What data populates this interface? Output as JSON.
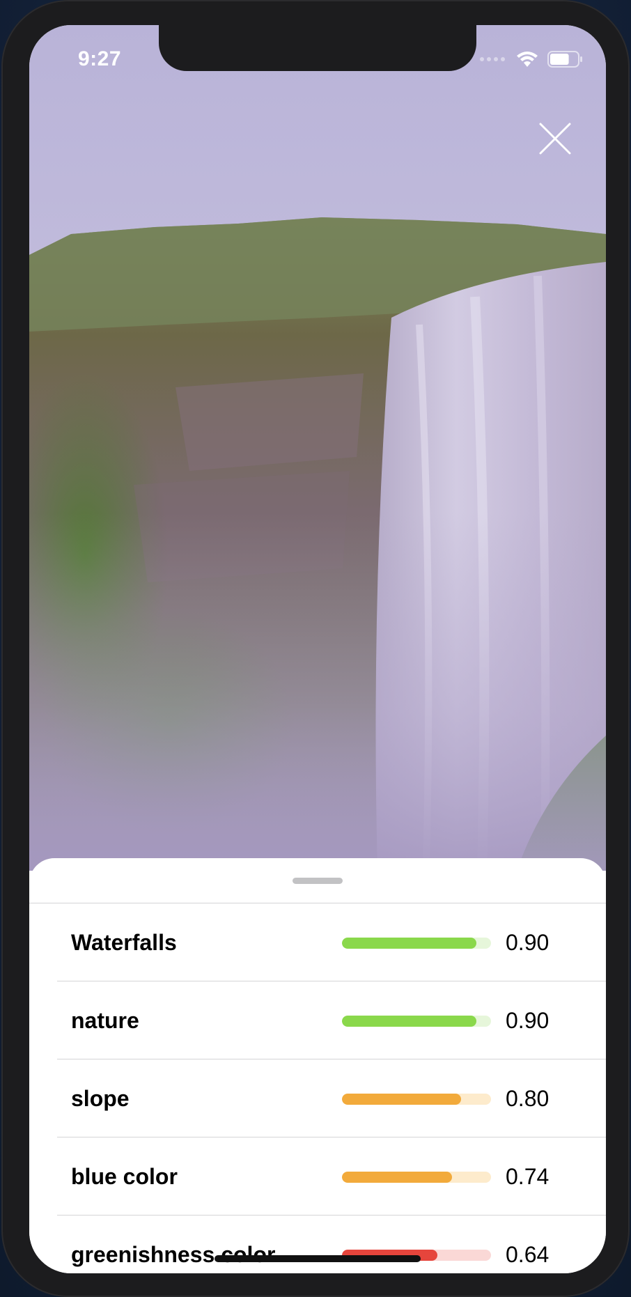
{
  "status_bar": {
    "time": "9:27",
    "signal_icon": "cellular-signal-icon",
    "wifi_icon": "wifi-icon",
    "battery_icon": "battery-icon",
    "battery_level": 0.7
  },
  "photo": {
    "subject": "waterfall-photo",
    "close_icon": "close-icon"
  },
  "results": {
    "items": [
      {
        "label": "Waterfalls",
        "score": "0.90",
        "level": 0.9,
        "color": "#8ad84b",
        "track": "#e6f6da"
      },
      {
        "label": "nature",
        "score": "0.90",
        "level": 0.9,
        "color": "#8ad84b",
        "track": "#e6f6da"
      },
      {
        "label": "slope",
        "score": "0.80",
        "level": 0.8,
        "color": "#f2aa3b",
        "track": "#fdebcc"
      },
      {
        "label": "blue color",
        "score": "0.74",
        "level": 0.74,
        "color": "#f2aa3b",
        "track": "#fdebcc"
      },
      {
        "label": "greenishness color",
        "score": "0.64",
        "level": 0.64,
        "color": "#e6453c",
        "track": "#fad8d6"
      }
    ]
  }
}
